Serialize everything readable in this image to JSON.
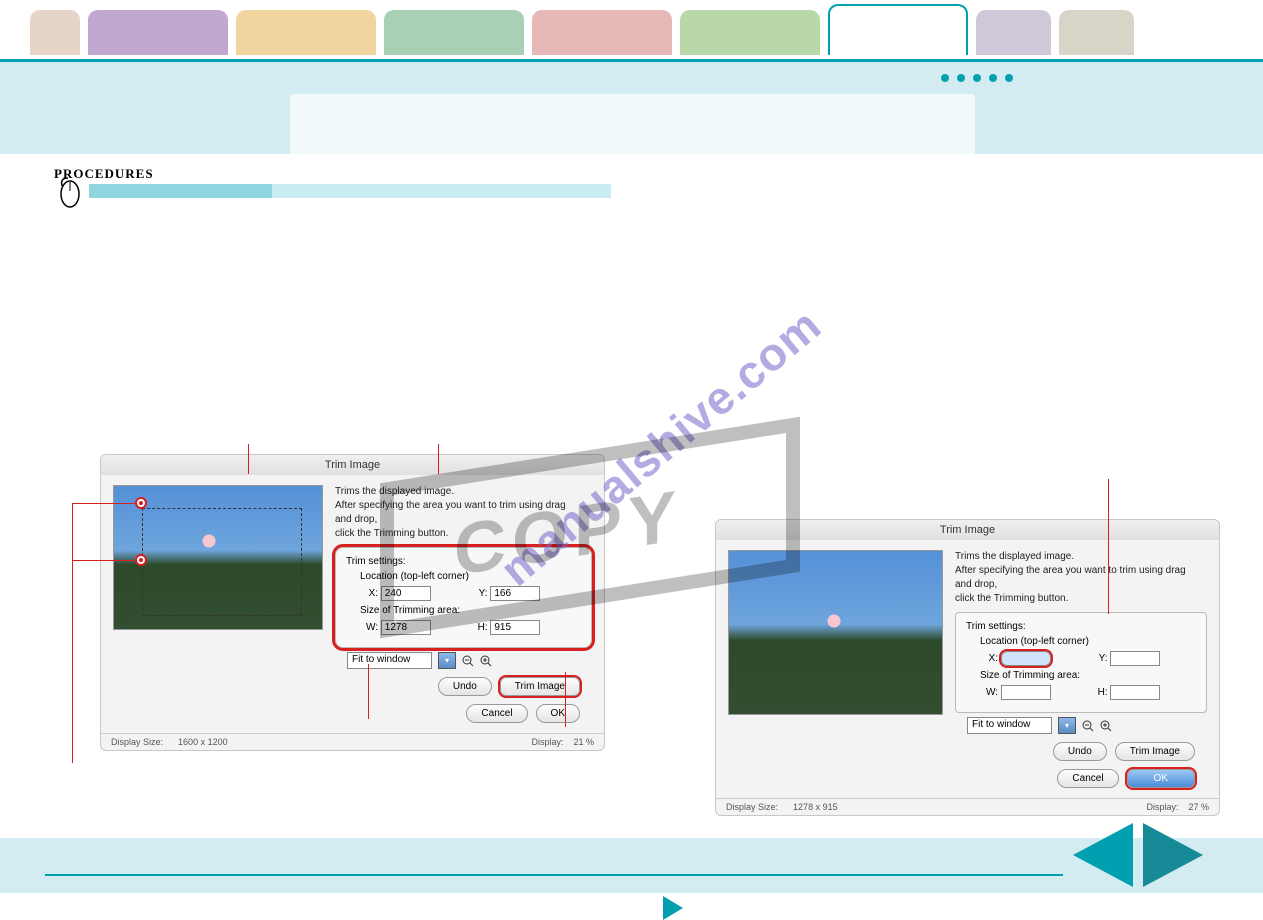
{
  "tabs": {
    "colors": [
      "#e7d4c8",
      "#c0a8d0",
      "#f2d59e",
      "#a8d0b4",
      "#e6b8b8",
      "#b8d8a8",
      "#ffffff",
      "#d0c8d8",
      "#d8d4c8"
    ],
    "active_index": 6
  },
  "procedures_label": "PROCEDURES",
  "panel1": {
    "title": "Trim Image",
    "desc1": "Trims the displayed image.",
    "desc2": "After specifying the area you want to trim using drag",
    "desc3": "and drop,",
    "desc4": "click the Trimming button.",
    "settings_title": "Trim settings:",
    "loc_label": "Location (top-left corner)",
    "x_label": "X:",
    "x_value": "240",
    "y_label": "Y:",
    "y_value": "166",
    "size_label": "Size of Trimming area:",
    "w_label": "W:",
    "w_value": "1278",
    "h_label": "H:",
    "h_value": "915",
    "fit_label": "Fit to window",
    "undo_label": "Undo",
    "trim_label": "Trim Image",
    "cancel_label": "Cancel",
    "ok_label": "OK",
    "ds_label": "Display Size:",
    "ds_value": "1600 x 1200",
    "disp_label": "Display:",
    "disp_value": "21 %"
  },
  "panel2": {
    "title": "Trim Image",
    "desc1": "Trims the displayed image.",
    "desc2": "After specifying the area you want to trim using drag",
    "desc3": "and drop,",
    "desc4": "click the Trimming button.",
    "settings_title": "Trim settings:",
    "loc_label": "Location (top-left corner)",
    "x_label": "X:",
    "x_value": "",
    "y_label": "Y:",
    "y_value": "",
    "size_label": "Size of Trimming area:",
    "w_label": "W:",
    "w_value": "",
    "h_label": "H:",
    "h_value": "",
    "fit_label": "Fit to window",
    "undo_label": "Undo",
    "trim_label": "Trim Image",
    "cancel_label": "Cancel",
    "ok_label": "OK",
    "ds_label": "Display Size:",
    "ds_value": "1278 x 915",
    "disp_label": "Display:",
    "disp_value": "27 %"
  },
  "watermark1": "manualshive.com",
  "watermark2": "COPY"
}
